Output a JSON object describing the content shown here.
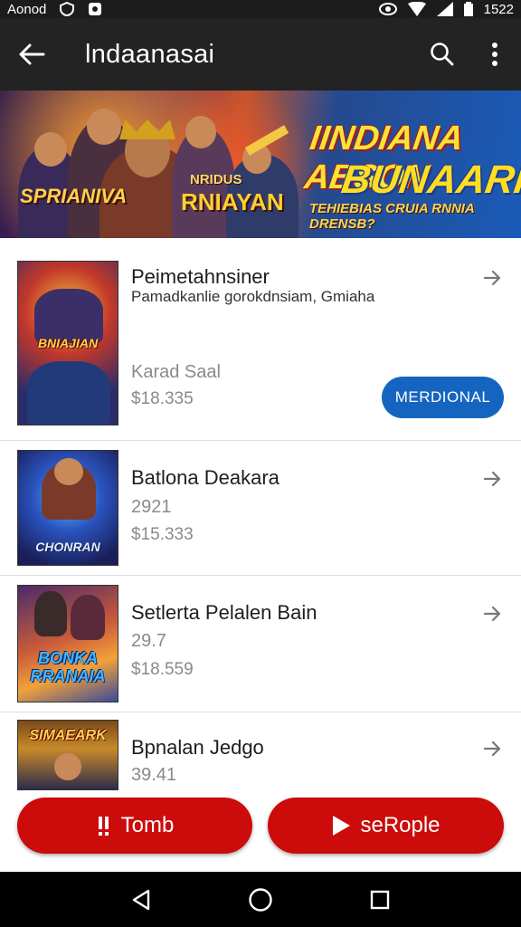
{
  "status_bar": {
    "carrier": "Aonod",
    "time": "1522"
  },
  "app_bar": {
    "title": "lndaanasai"
  },
  "banner": {
    "headline_line1": "IINDIANA ABSON",
    "headline_line2": "BUNAARH",
    "tagline": "TEHIEBIAS CRUIA RNNIA DRENSB?",
    "left_logo": "SPRIANIVA",
    "center_small": "NRIDUS",
    "center_big": "RNIAYAN"
  },
  "items": [
    {
      "name": "Peimetahnsiner",
      "subtitle": "Pamadkanlie gorokdnsiam, Gmiaha",
      "meta1": "Karad Saal",
      "meta2": "$18.335",
      "action_label": "MERDIONAL",
      "thumb_title": "BNIAJIAN"
    },
    {
      "name": "Batlona Deakara",
      "meta1": "2921",
      "meta2": "$15.333",
      "thumb_title": "CHONRAN"
    },
    {
      "name": "Setlerta Pelalen Bain",
      "meta1": "29.7",
      "meta2": "$18.559",
      "thumb_title": "BONKA RRANAIA"
    },
    {
      "name": "Bpnalan Jedgo",
      "meta1": "39.41",
      "thumb_title": "SIMAEARK"
    }
  ],
  "bottom_actions": {
    "left_label": "Tomb",
    "right_label": "seRople"
  },
  "colors": {
    "app_bar": "#232323",
    "accent_red": "#cc0b0b",
    "accent_blue": "#1565c0"
  }
}
